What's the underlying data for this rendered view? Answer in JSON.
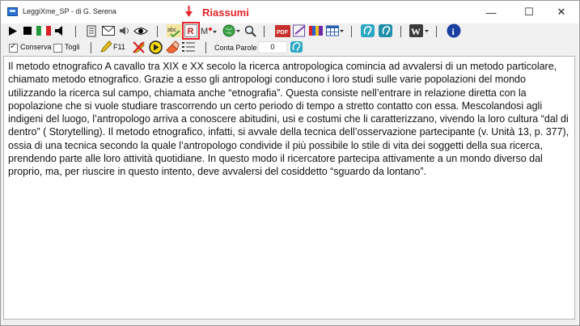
{
  "window": {
    "title": "LeggiXme_SP - di G. Serena",
    "controls": {
      "minimize": "—",
      "maximize": "☐",
      "close": "✕"
    }
  },
  "annotation": {
    "label": "Riassumi",
    "color": "#e8232a"
  },
  "toolbar1": {
    "items": [
      "play-icon",
      "stop-icon",
      "italian-flag-icon",
      "speaker-icon",
      "document-icon",
      "envelope-icon",
      "volume-icon",
      "eye-icon",
      "spellcheck-abc-icon",
      "summarize-icon",
      "translate-icon",
      "globe-icon",
      "magnifier-icon",
      "pdf-icon",
      "edit-document-icon",
      "color-palette-icon",
      "calendar-icon",
      "ear-icon",
      "ear-alt-icon",
      "word-icon",
      "info-icon"
    ],
    "word_label": "W",
    "info_label": "i",
    "pdf_label": "PDF",
    "abc_label": "abc",
    "summarize_label": "R",
    "m_label": "M"
  },
  "toolbar2": {
    "conserva_label": "Conserva",
    "conserva_checked": true,
    "togli_label": "Togli",
    "togli_checked": false,
    "f11_label": "F11",
    "conta_parole_label": "Conta Parole",
    "word_count": "0"
  },
  "document": {
    "text": "Il metodo etnografico A cavallo tra XIX e XX secolo la ricerca antropologica comincia ad avvalersi di un metodo particolare, chiamato metodo etnografico. Grazie a esso gli antropologi conducono i loro studi sulle varie popolazioni del mondo utilizzando la ricerca sul campo, chiamata anche “etnografia”. Questa consiste nell’entrare in relazione diretta con la popolazione che si vuole studiare trascorrendo un certo periodo di tempo a stretto contatto con essa. Mescolandosi agli indigeni del luogo, l’antropologo arriva a conoscere abitudini, usi e costumi che li caratterizzano, vivendo la loro cultura “dal di dentro” ( Storytelling). Il metodo etnografico, infatti, si avvale della tecnica dell’osservazione partecipante (v. Unità 13, p. 377), ossia di una tecnica secondo la quale l’antropologo condivide il più possibile lo stile di vita dei soggetti della sua ricerca, prendendo parte alle loro attività quotidiane. In questo modo il ricercatore partecipa attivamente a un mondo diverso dal proprio, ma, per riuscire in questo intento, deve avvalersi del cosiddetto “sguardo da lontano”."
  }
}
